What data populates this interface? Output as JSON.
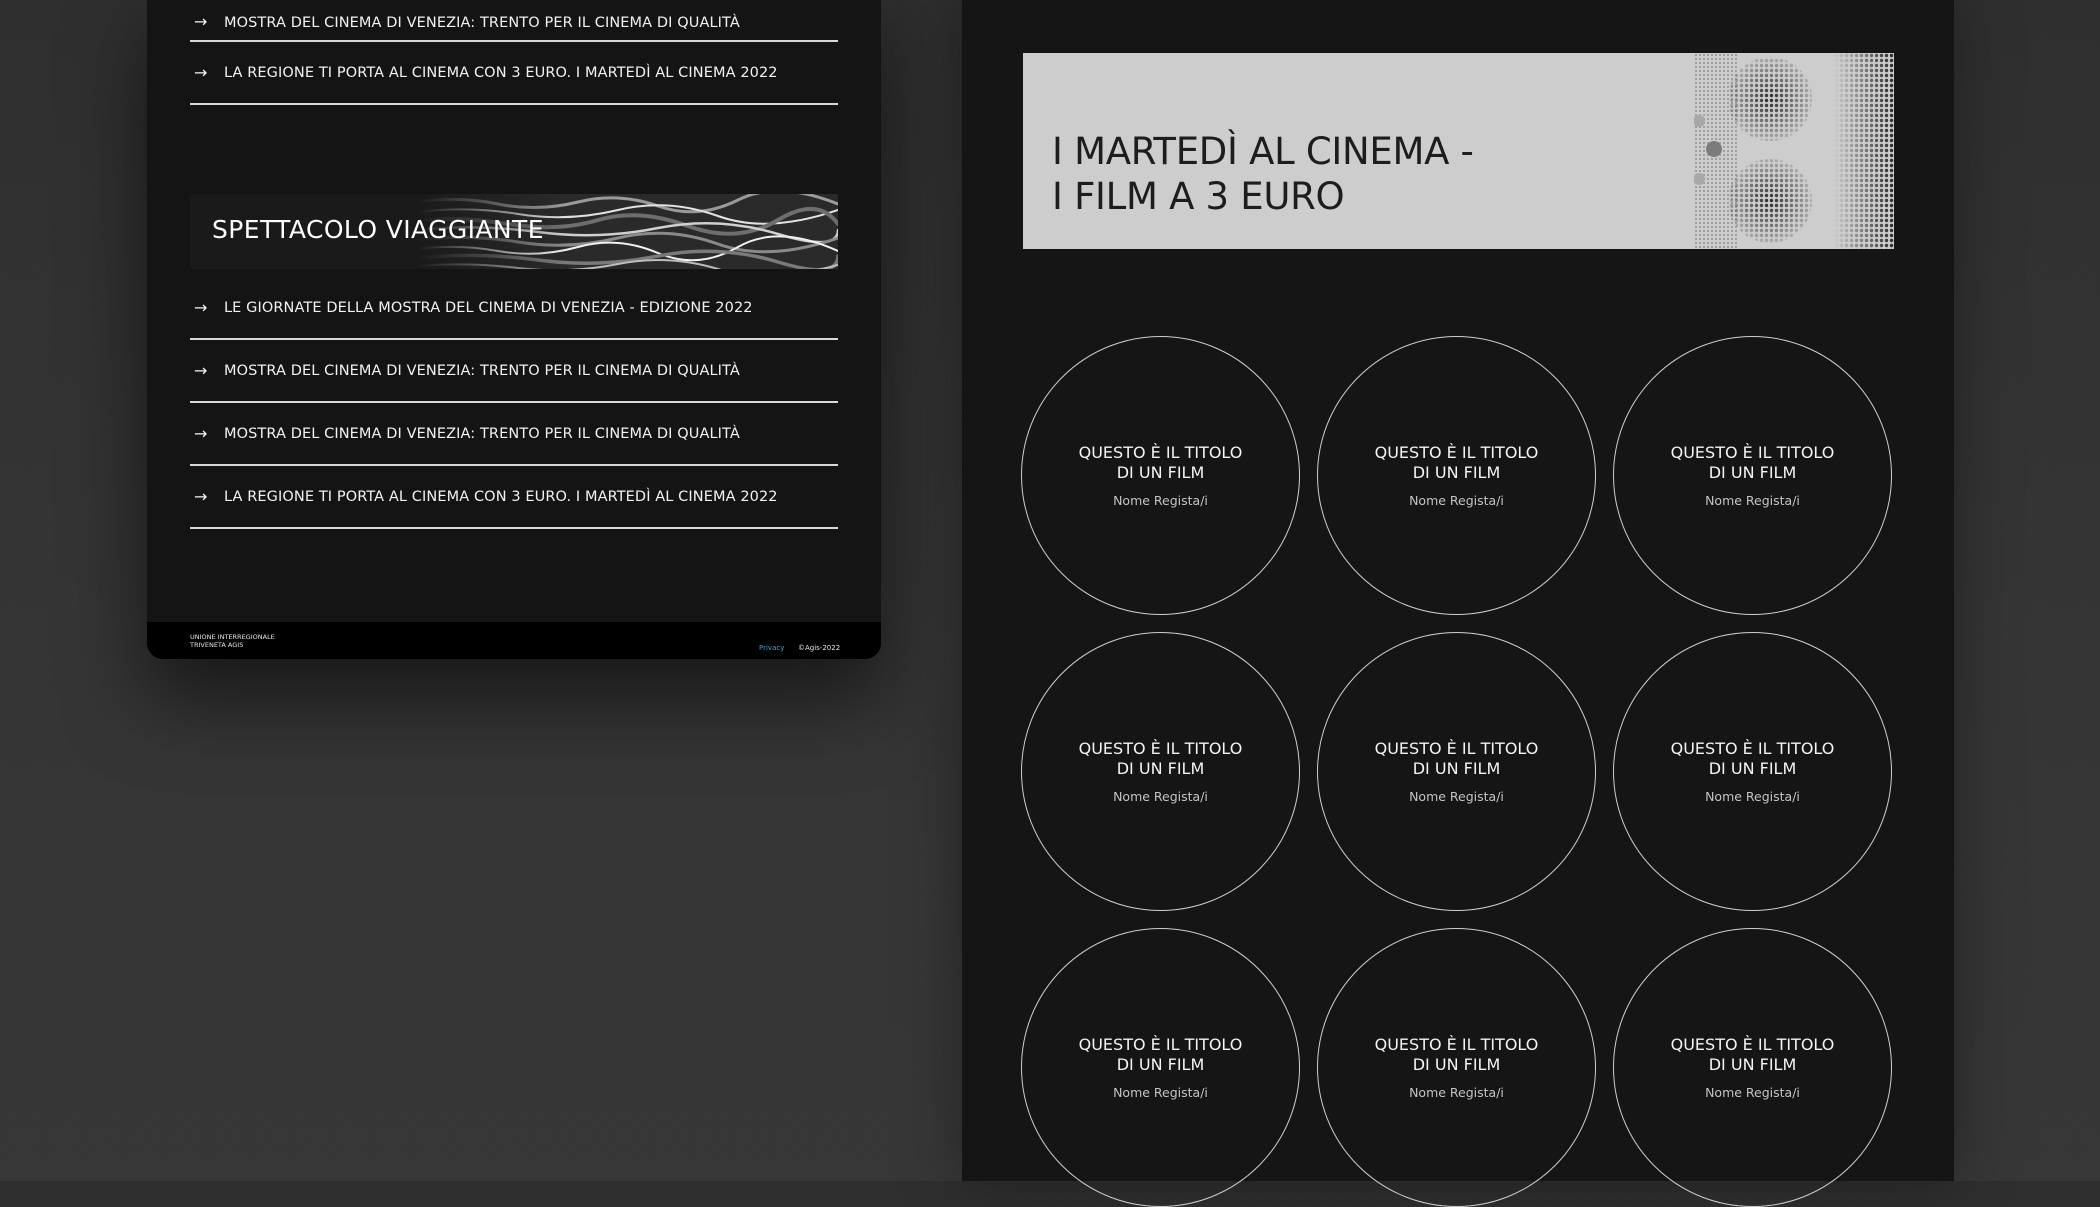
{
  "left_panel": {
    "top_links": [
      {
        "label": "MOSTRA DEL CINEMA DI VENEZIA: TRENTO PER IL CINEMA DI QUALITÀ"
      },
      {
        "label": "LA REGIONE TI PORTA AL CINEMA CON 3 EURO. I MARTEDÌ AL CINEMA 2022"
      }
    ],
    "section_title": "SPETTACOLO VIAGGIANTE",
    "section_links": [
      {
        "label": "LE GIORNATE DELLA MOSTRA DEL CINEMA DI VENEZIA - EDIZIONE 2022"
      },
      {
        "label": "MOSTRA DEL CINEMA DI VENEZIA: TRENTO PER IL CINEMA DI QUALITÀ"
      },
      {
        "label": "MOSTRA DEL CINEMA DI VENEZIA: TRENTO PER IL CINEMA DI QUALITÀ"
      },
      {
        "label": "LA REGIONE TI PORTA AL CINEMA CON 3 EURO. I MARTEDÌ AL CINEMA 2022"
      }
    ],
    "footer": {
      "org_line1": "UNIONE INTERREGIONALE",
      "org_line2": "TRIVENETA AGIS",
      "privacy": "Privacy",
      "copyright": "©Agis-2022"
    },
    "arrow_icon": "arrow-right-icon"
  },
  "right_panel": {
    "hero_title_line1": "I MARTEDÌ AL CINEMA -",
    "hero_title_line2": "I FILM A 3 EURO",
    "films": [
      {
        "title": "QUESTO È IL TITOLO DI UN FILM",
        "director": "Nome Regista/i"
      },
      {
        "title": "QUESTO È IL TITOLO DI UN FILM",
        "director": "Nome Regista/i"
      },
      {
        "title": "QUESTO È IL TITOLO DI UN FILM",
        "director": "Nome Regista/i"
      },
      {
        "title": "QUESTO È IL TITOLO DI UN FILM",
        "director": "Nome Regista/i"
      },
      {
        "title": "QUESTO È IL TITOLO DI UN FILM",
        "director": "Nome Regista/i"
      },
      {
        "title": "QUESTO È IL TITOLO DI UN FILM",
        "director": "Nome Regista/i"
      },
      {
        "title": "QUESTO È IL TITOLO DI UN FILM",
        "director": "Nome Regista/i"
      },
      {
        "title": "QUESTO È IL TITOLO DI UN FILM",
        "director": "Nome Regista/i"
      },
      {
        "title": "QUESTO È IL TITOLO DI UN FILM",
        "director": "Nome Regista/i"
      }
    ]
  },
  "colors": {
    "background": "#333333",
    "card": "#141414",
    "hero_background": "#cdcdcd",
    "link_accent": "#3ba5d6"
  }
}
